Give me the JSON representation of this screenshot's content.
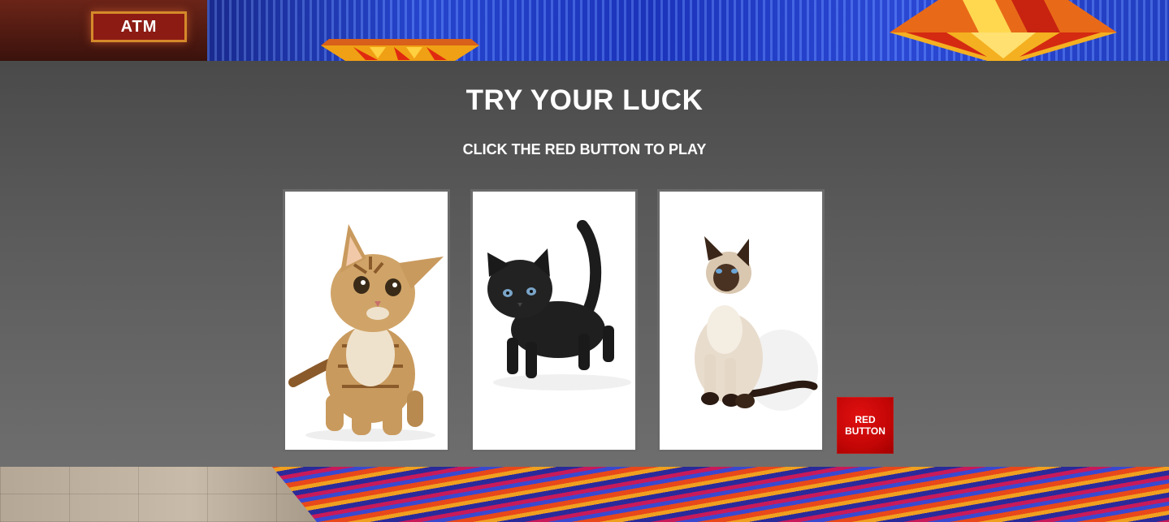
{
  "banner": {
    "atm_sign": "ATM"
  },
  "game": {
    "title": "TRY YOUR LUCK",
    "subtitle": "CLICK THE RED BUTTON TO PLAY",
    "red_button_label": "RED BUTTON",
    "cards": [
      {
        "icon": "orange-tabby-kitten"
      },
      {
        "icon": "black-kitten"
      },
      {
        "icon": "siamese-cat"
      }
    ]
  },
  "colors": {
    "panel_top": "#4a4a4a",
    "panel_bottom": "#6e6e6e",
    "red_button": "#c40606",
    "card_border": "#6a6a6a"
  }
}
